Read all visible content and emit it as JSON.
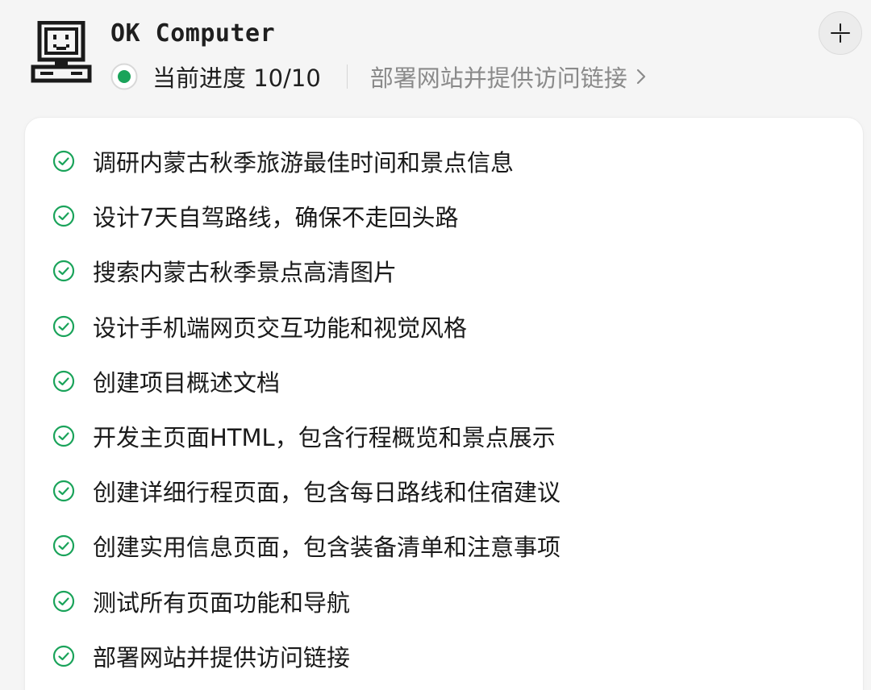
{
  "header": {
    "app_title": "OK Computer",
    "progress_text": "当前进度 10/10",
    "current_step": "部署网站并提供访问链接",
    "icons": {
      "app": "computer-icon",
      "status": "status-dot-icon",
      "chevron": "chevron-right-icon",
      "collapse": "collapse-icon"
    }
  },
  "colors": {
    "accent_green": "#1aa35a",
    "muted_text": "#8a8a8a",
    "background": "#f5f5f5"
  },
  "tasks": [
    {
      "label": "调研内蒙古秋季旅游最佳时间和景点信息",
      "status": "done"
    },
    {
      "label": "设计7天自驾路线，确保不走回头路",
      "status": "done"
    },
    {
      "label": "搜索内蒙古秋季景点高清图片",
      "status": "done"
    },
    {
      "label": "设计手机端网页交互功能和视觉风格",
      "status": "done"
    },
    {
      "label": "创建项目概述文档",
      "status": "done"
    },
    {
      "label": "开发主页面HTML，包含行程概览和景点展示",
      "status": "done"
    },
    {
      "label": "创建详细行程页面，包含每日路线和住宿建议",
      "status": "done"
    },
    {
      "label": "创建实用信息页面，包含装备清单和注意事项",
      "status": "done"
    },
    {
      "label": "测试所有页面功能和导航",
      "status": "done"
    },
    {
      "label": "部署网站并提供访问链接",
      "status": "done"
    }
  ]
}
